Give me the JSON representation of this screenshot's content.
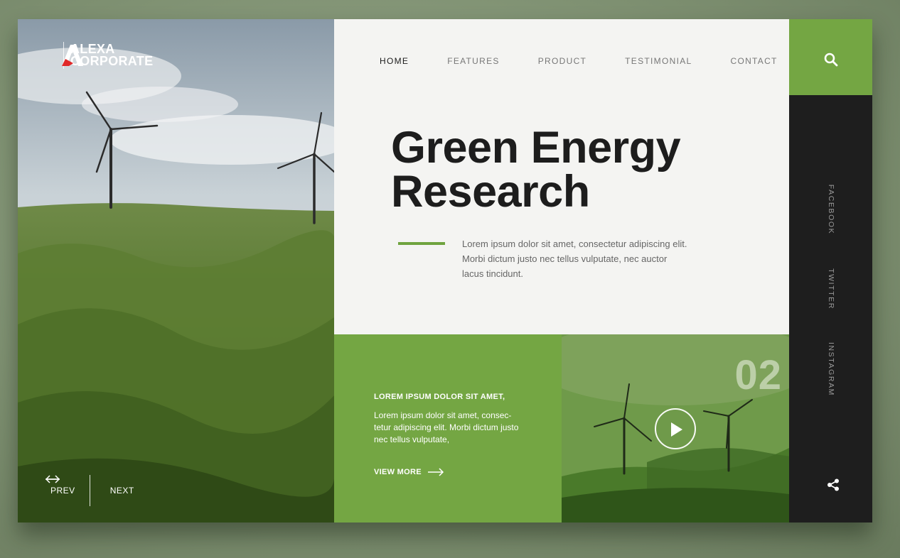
{
  "brand": {
    "line1": "ALEXA",
    "line2": "CORPORATE"
  },
  "nav": {
    "items": [
      "HOME",
      "FEATURES",
      "PRODUCT",
      "TESTIMONIAL",
      "CONTACT"
    ],
    "active": "HOME"
  },
  "hero": {
    "title_line1": "Green Energy",
    "title_line2": "Research",
    "intro": "Lorem ipsum dolor sit amet, consectetur adipiscing elit. Morbi dictum justo nec tellus vulputate, nec auctor lacus tincidunt."
  },
  "pager": {
    "prev": "PREV",
    "next": "NEXT"
  },
  "card": {
    "title": "LOREM IPSUM DOLOR SIT AMET,",
    "body": "Lorem ipsum dolor sit amet, consec-tetur adipiscing elit. Morbi dictum justo nec tellus vulputate,",
    "link": "VIEW MORE"
  },
  "slide": {
    "number": "02"
  },
  "social": {
    "items": [
      "FACEBOOK",
      "TWITTER",
      "INSTAGRAM"
    ]
  },
  "icons": {
    "search": "search-icon",
    "play": "play-icon",
    "share": "share-icon",
    "prev": "arrow-left-icon",
    "next": "arrow-right-icon"
  },
  "colors": {
    "accent": "#74a643",
    "dark": "#1e1e1e",
    "headline": "#1d1d1d"
  }
}
